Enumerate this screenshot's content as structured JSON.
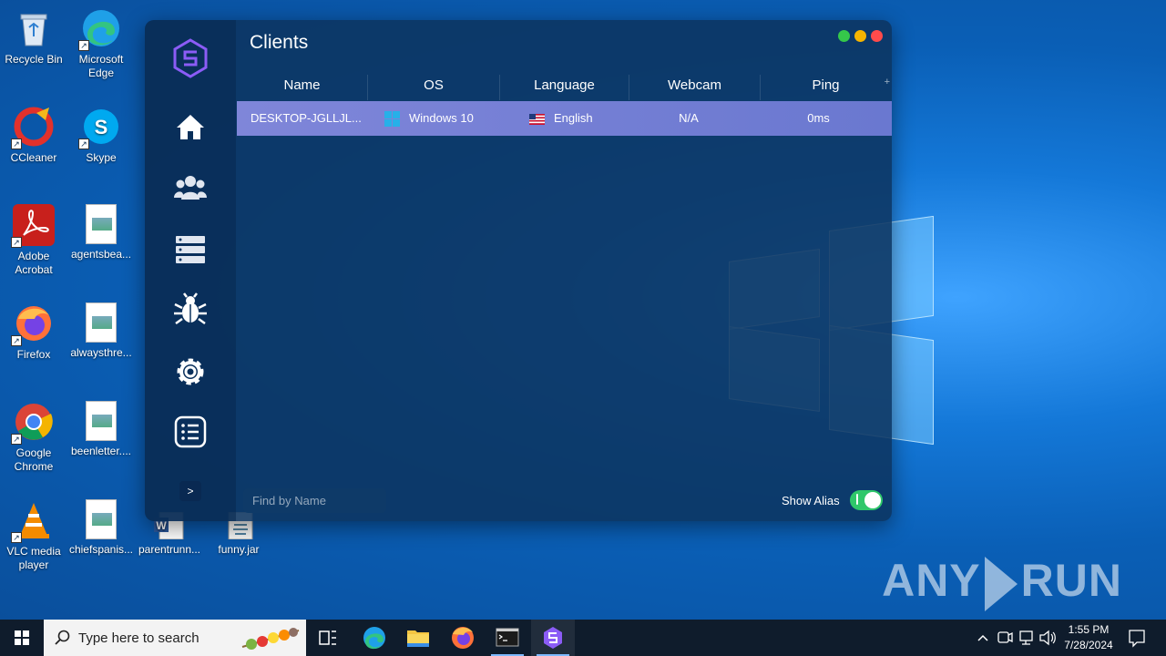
{
  "desktop": {
    "icons": [
      {
        "label": "Recycle Bin"
      },
      {
        "label": "Microsoft Edge"
      },
      {
        "label": "CCleaner"
      },
      {
        "label": "Skype"
      },
      {
        "label": "Adobe Acrobat"
      },
      {
        "label": "agentsbea..."
      },
      {
        "label": "Firefox"
      },
      {
        "label": "alwaysthre..."
      },
      {
        "label": "Google Chrome"
      },
      {
        "label": "beenletter...."
      },
      {
        "label": "VLC media player"
      },
      {
        "label": "chiefspanis..."
      },
      {
        "label": "parentrunn..."
      },
      {
        "label": "funny.jar"
      }
    ],
    "watermark": {
      "left": "ANY",
      "right": "RUN"
    }
  },
  "app": {
    "title": "Clients",
    "accent_color": "#8b5cf6",
    "window_controls": {
      "green": "#35c84a",
      "yellow": "#f5b400",
      "red": "#ff4b4b"
    },
    "sidebar": {
      "items": [
        {
          "name": "home",
          "icon": "home-icon"
        },
        {
          "name": "clients",
          "icon": "users-icon"
        },
        {
          "name": "servers",
          "icon": "server-icon"
        },
        {
          "name": "debug",
          "icon": "bug-icon"
        },
        {
          "name": "settings",
          "icon": "gear-icon"
        },
        {
          "name": "logs",
          "icon": "list-icon"
        }
      ],
      "expand_label": ">"
    },
    "table": {
      "columns": [
        "Name",
        "OS",
        "Language",
        "Webcam",
        "Ping"
      ],
      "add_column_label": "+",
      "rows": [
        {
          "name": "DESKTOP-JGLLJL...",
          "os": "Windows 10",
          "language": "English",
          "webcam": "N/A",
          "ping": "0ms"
        }
      ]
    },
    "footer": {
      "search_placeholder": "Find by Name",
      "show_alias_label": "Show Alias",
      "show_alias_on": true
    }
  },
  "taskbar": {
    "search_placeholder": "Type here to search",
    "apps": [
      "task-view",
      "edge",
      "file-explorer",
      "firefox",
      "terminal",
      "client-app"
    ],
    "clock": {
      "time": "1:55 PM",
      "date": "7/28/2024"
    }
  }
}
